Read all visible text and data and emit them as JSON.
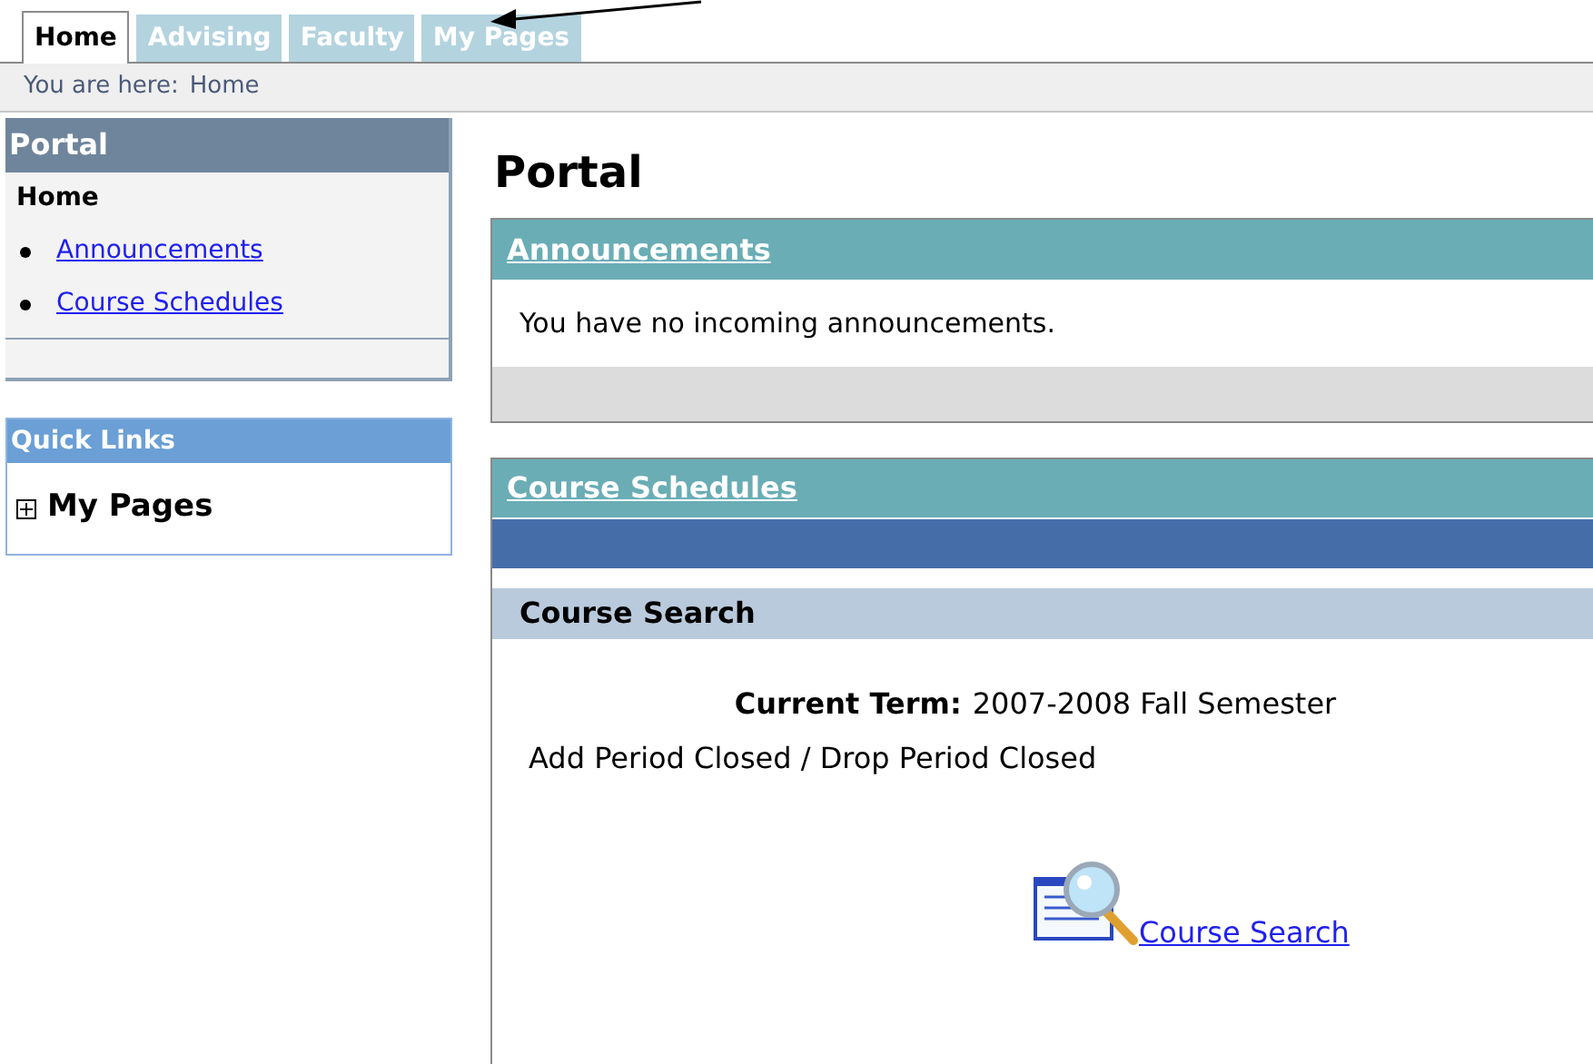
{
  "tabs": [
    {
      "label": "Home",
      "selected": true
    },
    {
      "label": "Advising",
      "selected": false
    },
    {
      "label": "Faculty",
      "selected": false
    },
    {
      "label": "My Pages",
      "selected": false
    }
  ],
  "breadcrumb": {
    "label": "You are here:",
    "current": "Home"
  },
  "sidebar": {
    "portal": {
      "title": "Portal",
      "heading": "Home",
      "links": [
        "Announcements",
        "Course Schedules"
      ]
    },
    "quick_links": {
      "title": "Quick Links",
      "items": [
        {
          "label": "My Pages",
          "expanded": false
        }
      ]
    }
  },
  "page_title": "Portal",
  "announcements": {
    "title": "Announcements",
    "message": "You have no incoming announcements."
  },
  "course_schedules": {
    "title": "Course Schedules",
    "section": "Course Search",
    "term_label": "Current Term:",
    "term_value": "2007-2008 Fall Semester",
    "status": "Add Period Closed / Drop Period Closed",
    "search_link": "Course Search"
  }
}
